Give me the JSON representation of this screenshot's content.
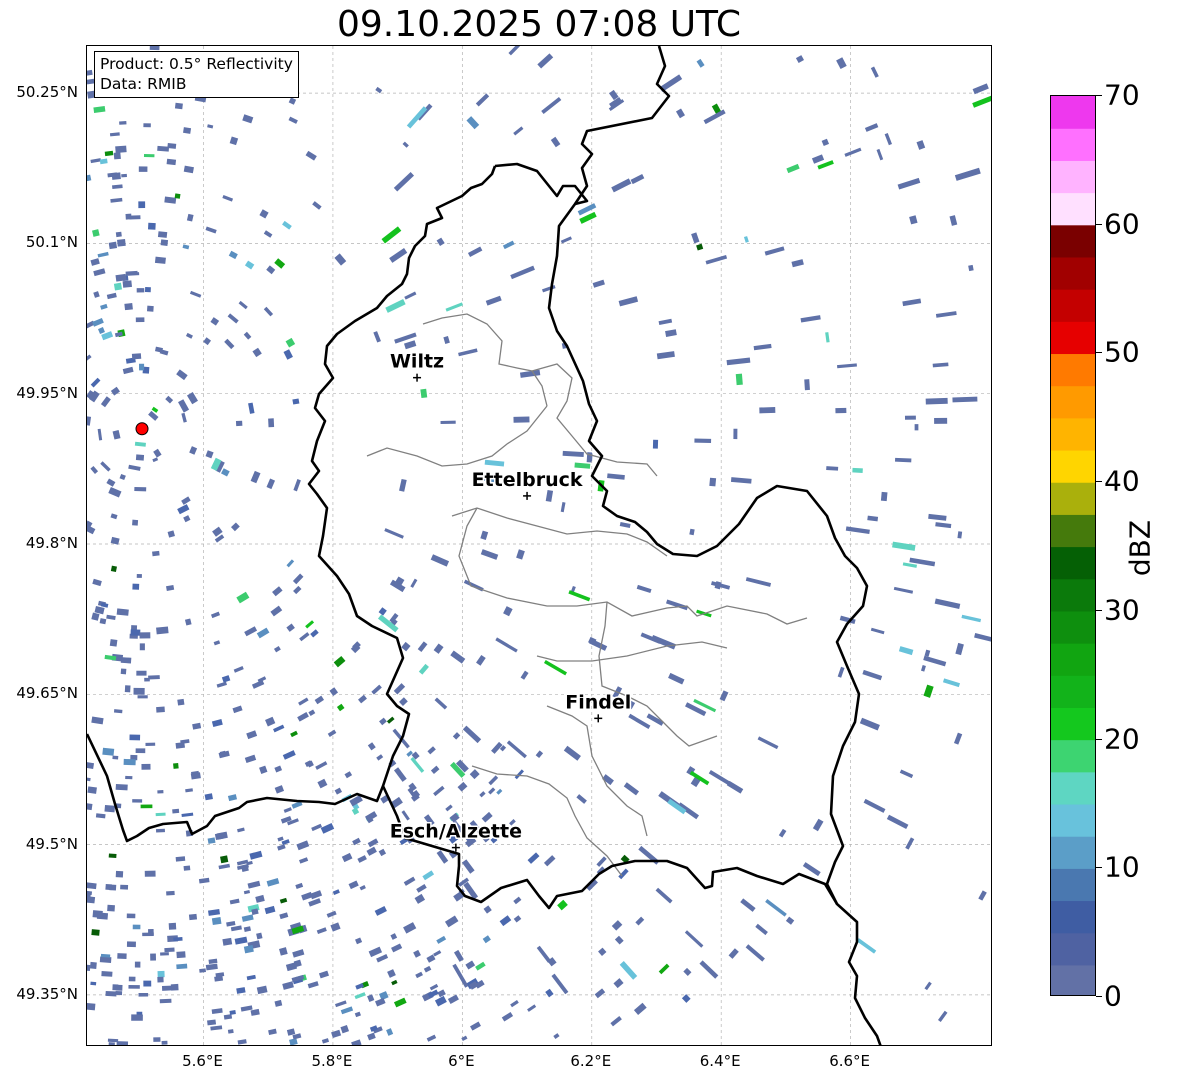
{
  "title": "09.10.2025 07:08 UTC",
  "info": {
    "product": "Product: 0.5° Reflectivity",
    "data": "Data: RMIB"
  },
  "map": {
    "lon_range": [
      5.42,
      6.82
    ],
    "lat_range": [
      49.298,
      50.297
    ],
    "lat_ticks": [
      {
        "value": 50.25,
        "label": "50.25°N"
      },
      {
        "value": 50.1,
        "label": "50.1°N"
      },
      {
        "value": 49.95,
        "label": "49.95°N"
      },
      {
        "value": 49.8,
        "label": "49.8°N"
      },
      {
        "value": 49.65,
        "label": "49.65°N"
      },
      {
        "value": 49.5,
        "label": "49.5°N"
      },
      {
        "value": 49.35,
        "label": "49.35°N"
      }
    ],
    "lon_ticks": [
      {
        "value": 5.6,
        "label": "5.6°E"
      },
      {
        "value": 5.8,
        "label": "5.8°E"
      },
      {
        "value": 6.0,
        "label": "6°E"
      },
      {
        "value": 6.2,
        "label": "6.2°E"
      },
      {
        "value": 6.4,
        "label": "6.4°E"
      },
      {
        "value": 6.6,
        "label": "6.6°E"
      }
    ],
    "gridlines": true,
    "radar_site": {
      "lon": 5.505,
      "lat": 49.915,
      "color": "#ff0000"
    },
    "cities": [
      {
        "name": "Wiltz",
        "lon": 5.93,
        "lat": 49.966
      },
      {
        "name": "Ettelbruck",
        "lon": 6.1,
        "lat": 49.848
      },
      {
        "name": "Findel",
        "lon": 6.21,
        "lat": 49.626
      },
      {
        "name": "Esch/Alzette",
        "lon": 5.99,
        "lat": 49.497
      }
    ],
    "country_border_color": "#000000",
    "canton_border_color": "#808080",
    "echo_colors": [
      "#5f71a8",
      "#4a68ae",
      "#5a8fc0",
      "#68c2da",
      "#5fd3c0",
      "#3ccc6e",
      "#14c21e",
      "#12a812",
      "#0c8e0c",
      "#075c07"
    ]
  },
  "colorbar": {
    "label": "dBZ",
    "min": 0,
    "max": 70,
    "tick_labels": [
      "0",
      "10",
      "20",
      "30",
      "40",
      "50",
      "60",
      "70"
    ],
    "colors": [
      "#6271a6",
      "#4f62a2",
      "#3f5da3",
      "#4a78b0",
      "#5b9ec8",
      "#68c2dc",
      "#5ed6c2",
      "#3dd471",
      "#14c81e",
      "#12b31a",
      "#11a511",
      "#0e8f0e",
      "#0b7a0b",
      "#056005",
      "#457a0c",
      "#aab00c",
      "#ffd500",
      "#ffb400",
      "#ff9a00",
      "#ff7a00",
      "#e60000",
      "#c40000",
      "#a10000",
      "#7a0000",
      "#ffe0ff",
      "#ffb3ff",
      "#ff70ff",
      "#ee38ee"
    ]
  }
}
